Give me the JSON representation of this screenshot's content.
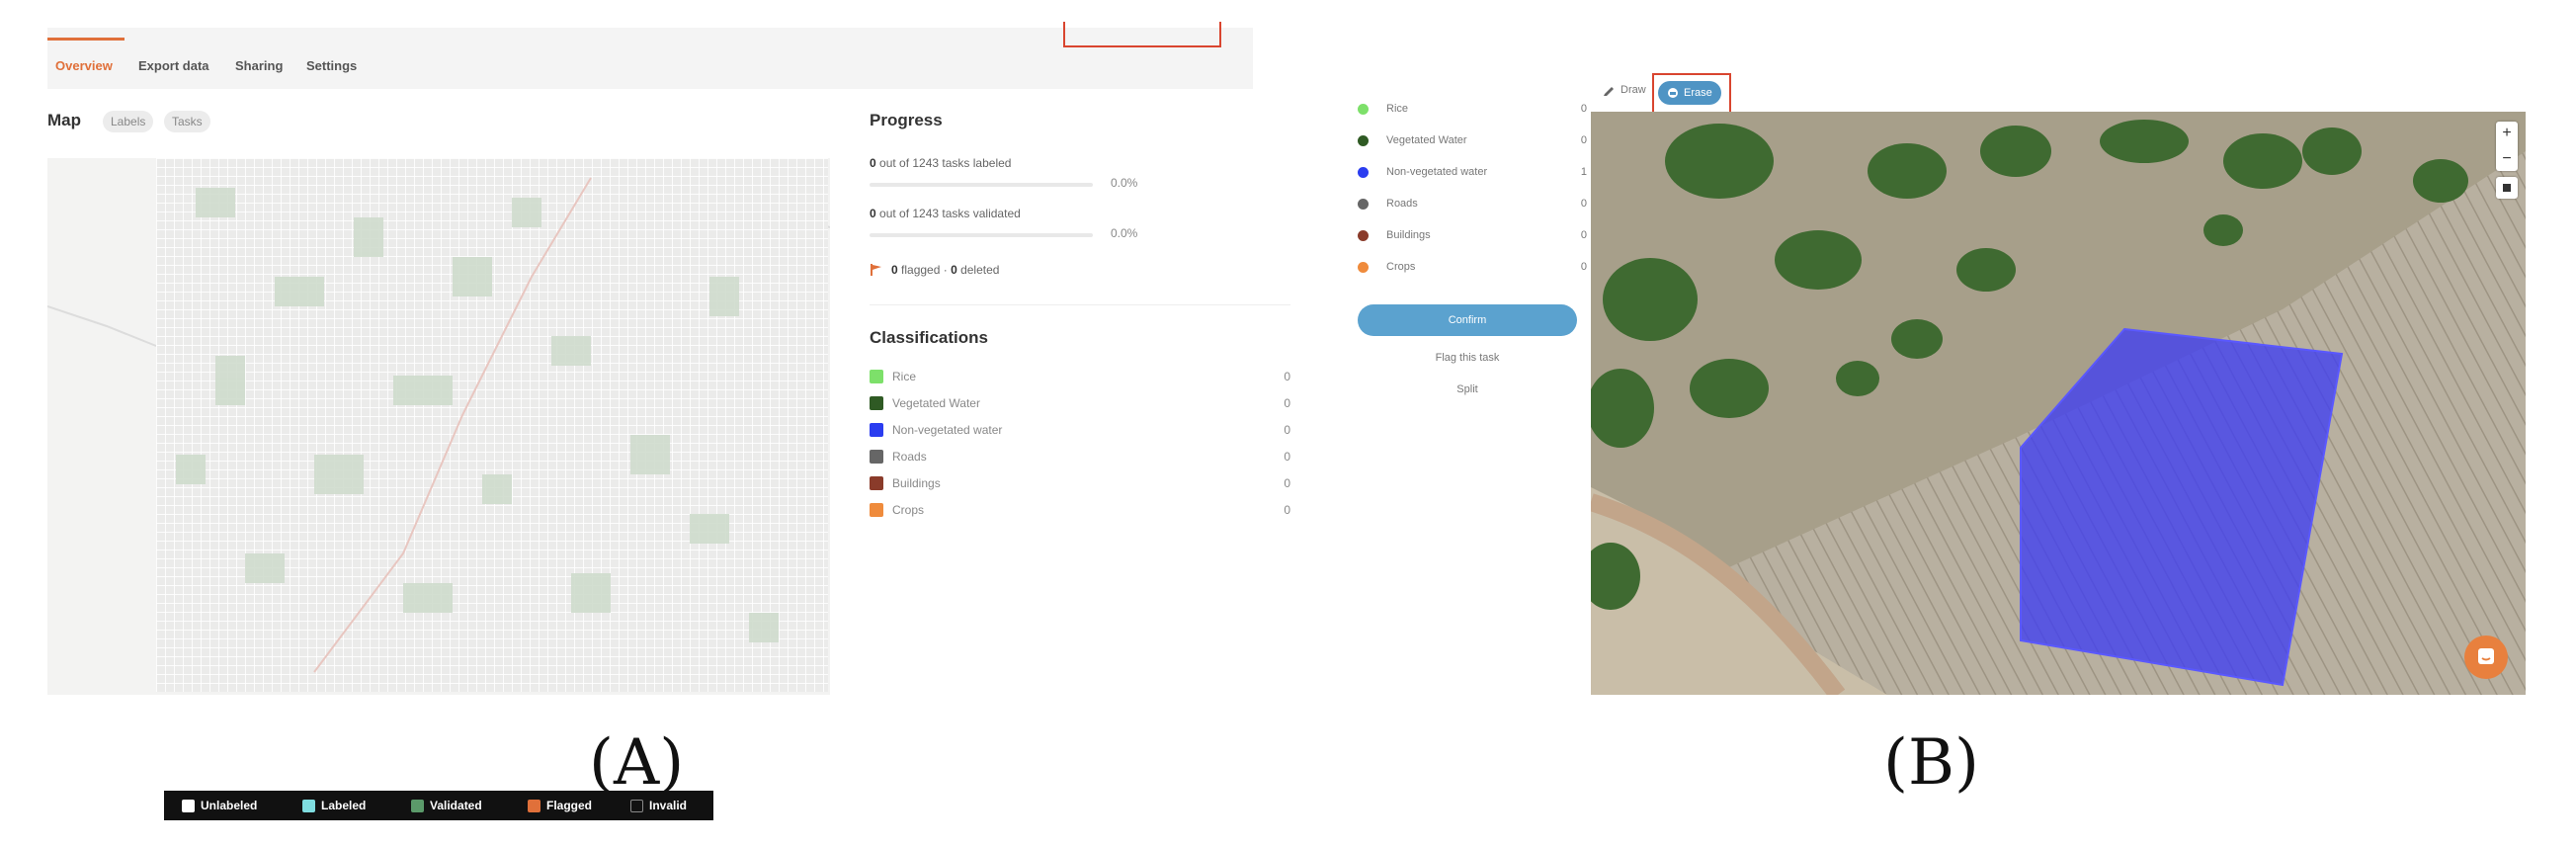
{
  "panel_a": {
    "tabs": [
      {
        "label": "Overview",
        "active": true
      },
      {
        "label": "Export data",
        "active": false
      },
      {
        "label": "Sharing",
        "active": false
      },
      {
        "label": "Settings",
        "active": false
      }
    ],
    "map": {
      "title": "Map",
      "chips": [
        "Labels",
        "Tasks"
      ],
      "legend": [
        {
          "label": "Unlabeled",
          "color": "#ffffff"
        },
        {
          "label": "Labeled",
          "color": "#7fdde0"
        },
        {
          "label": "Validated",
          "color": "#5b9a6a"
        },
        {
          "label": "Flagged",
          "color": "#e0703a"
        },
        {
          "label": "Invalid",
          "color": "#333333"
        }
      ]
    },
    "progress": {
      "title": "Progress",
      "labeled": {
        "count": "0",
        "text": " out of 1243 tasks labeled",
        "pct": "0.0%",
        "fraction": 0
      },
      "validated": {
        "count": "0",
        "text": " out of 1243 tasks validated",
        "pct": "0.0%",
        "fraction": 0
      },
      "flagged_count": "0",
      "flagged_text": " flagged · ",
      "deleted_count": "0",
      "deleted_text": " deleted",
      "accent_color": "#e0703a"
    },
    "classifications": {
      "title": "Classifications",
      "items": [
        {
          "label": "Rice",
          "count": "0",
          "color": "#7de06a"
        },
        {
          "label": "Vegetated Water",
          "count": "0",
          "color": "#2f5a24"
        },
        {
          "label": "Non-vegetated water",
          "count": "0",
          "color": "#2b3df0"
        },
        {
          "label": "Roads",
          "count": "0",
          "color": "#666666"
        },
        {
          "label": "Buildings",
          "count": "0",
          "color": "#8a3b2a"
        },
        {
          "label": "Crops",
          "count": "0",
          "color": "#ef8b3c"
        }
      ]
    }
  },
  "panel_b": {
    "classes": [
      {
        "label": "Rice",
        "count": "0",
        "color": "#7de06a"
      },
      {
        "label": "Vegetated Water",
        "count": "0",
        "color": "#2f5a24"
      },
      {
        "label": "Non-vegetated water",
        "count": "1",
        "color": "#2b3df0"
      },
      {
        "label": "Roads",
        "count": "0",
        "color": "#666666"
      },
      {
        "label": "Buildings",
        "count": "0",
        "color": "#8a3b2a"
      },
      {
        "label": "Crops",
        "count": "0",
        "color": "#ef8b3c"
      }
    ],
    "confirm_label": "Confirm",
    "flag_label": "Flag this task",
    "split_label": "Split",
    "draw_label": "Draw",
    "erase_label": "Erase",
    "zoom_in": "+",
    "zoom_out": "−",
    "polygon_color": "#3f3df2"
  },
  "captions": {
    "a": "(A)",
    "b": "(B)"
  }
}
